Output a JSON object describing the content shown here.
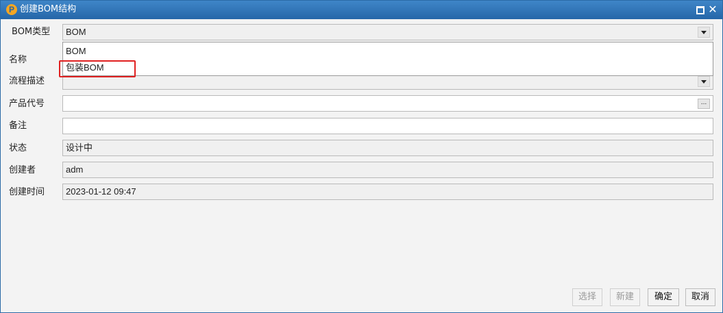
{
  "window": {
    "title": "创建BOM结构"
  },
  "form": {
    "bom_type_label": "BOM类型",
    "bom_type_value": "BOM",
    "bom_type_options": [
      "BOM",
      "包装BOM"
    ],
    "name_label": "名称",
    "process_desc_label": "流程描述",
    "product_code_label": "产品代号",
    "product_code_button": "...",
    "remark_label": "备注",
    "status_label": "状态",
    "status_value": "设计中",
    "creator_label": "创建者",
    "creator_value": "adm",
    "created_time_label": "创建时间",
    "created_time_value": "2023-01-12 09:47"
  },
  "buttons": {
    "select": "选择",
    "new": "新建",
    "ok": "确定",
    "cancel": "取消"
  },
  "colors": {
    "title_bar": "#2566a8",
    "highlight": "#e02020",
    "logo": "#f5a623"
  },
  "icons": {
    "logo": "app-logo-icon",
    "maximize": "maximize-icon",
    "close": "close-icon",
    "dropdown": "chevron-down-icon"
  }
}
